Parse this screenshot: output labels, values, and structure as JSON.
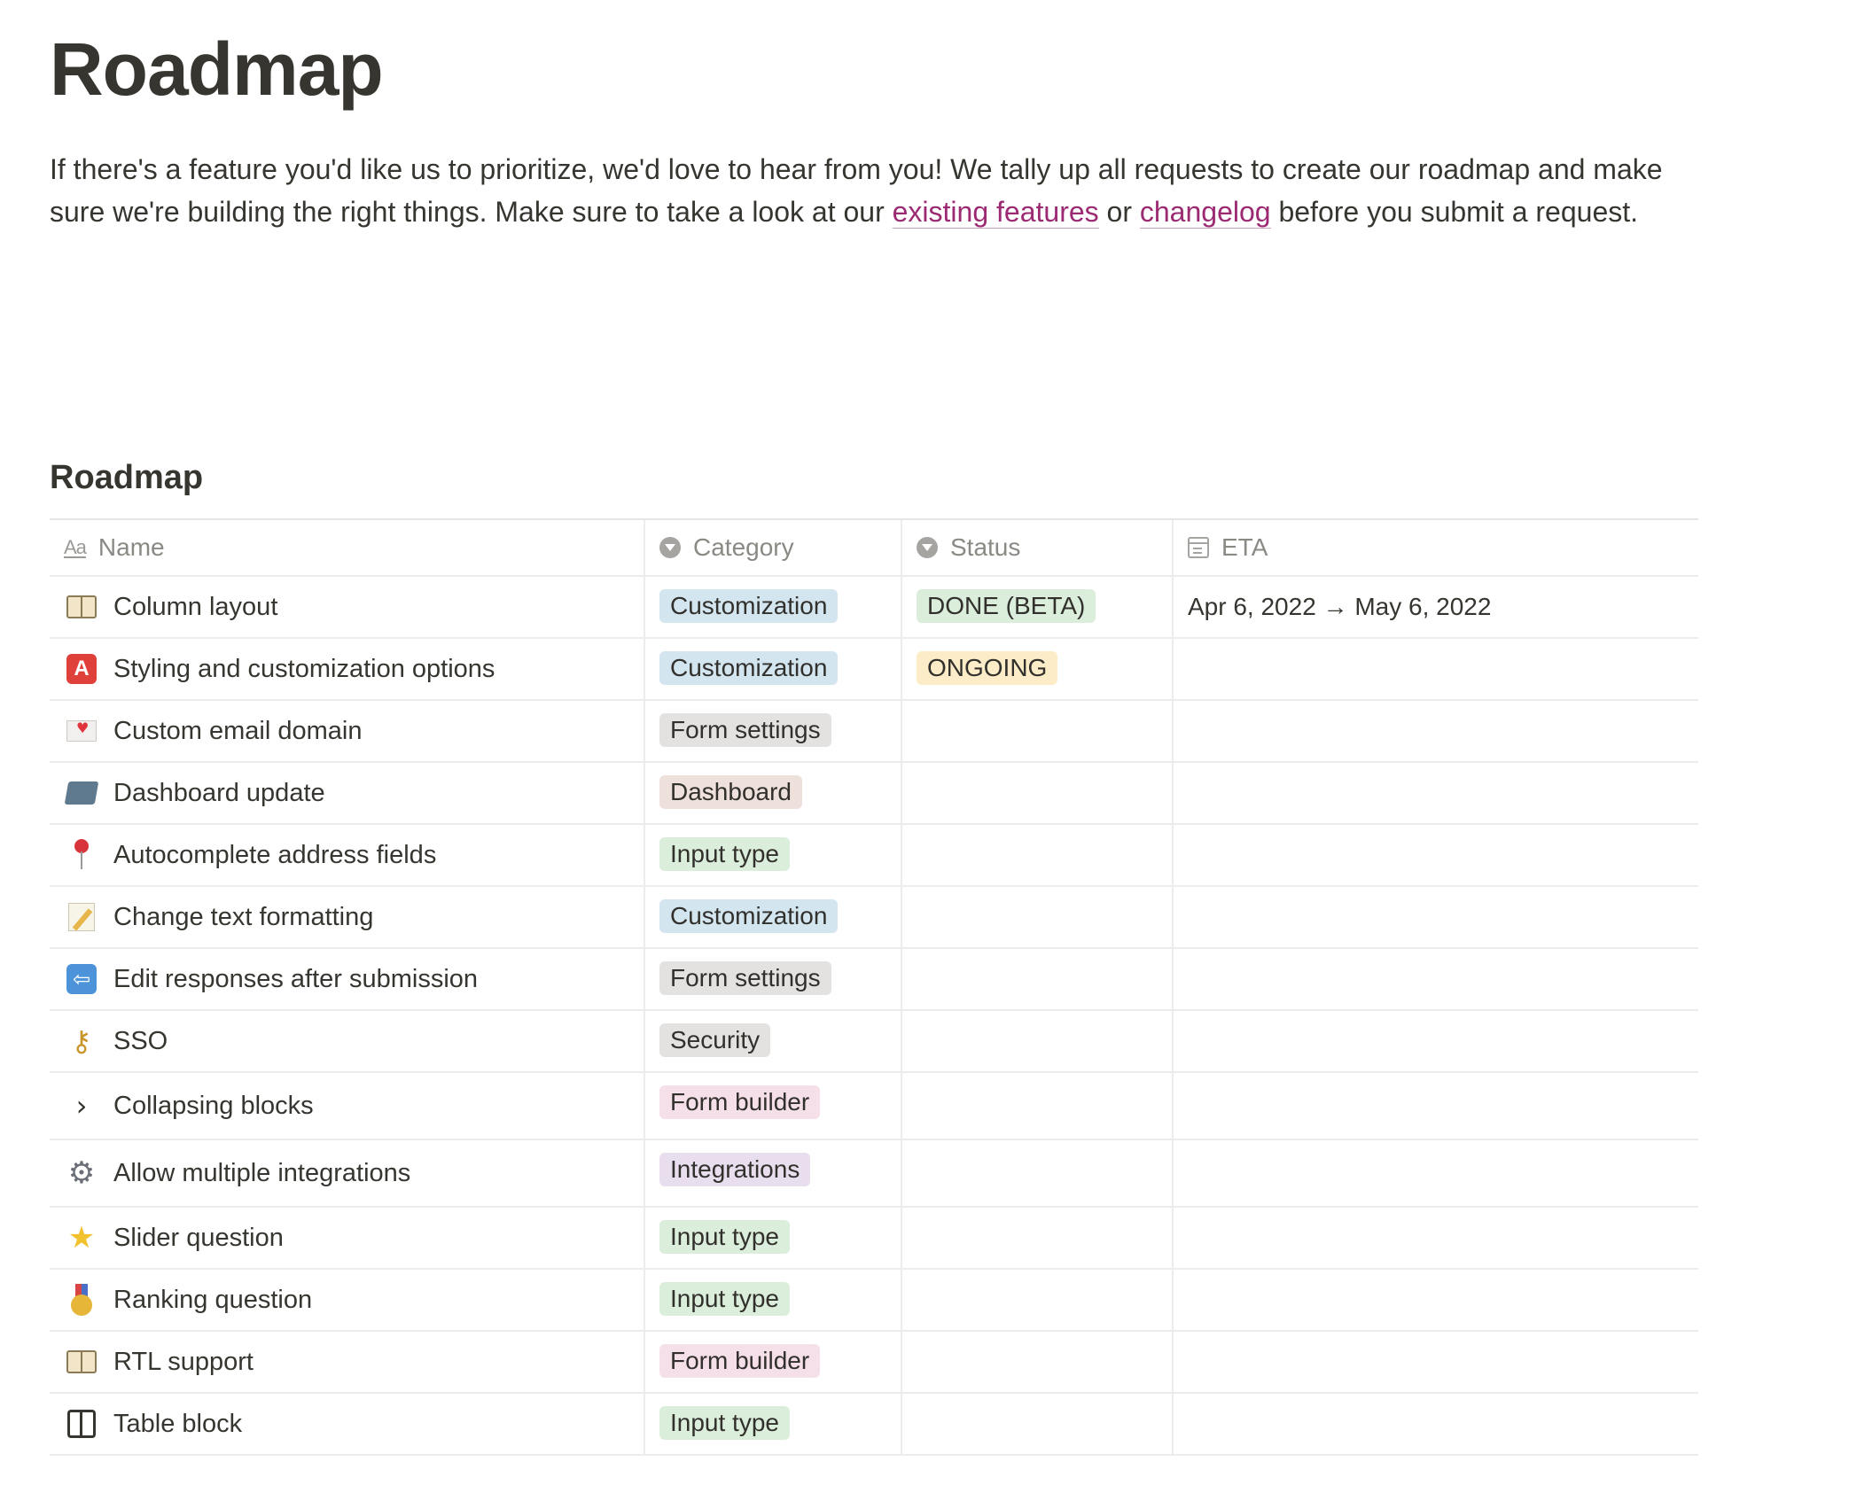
{
  "page": {
    "title": "Roadmap",
    "intro_before": "If there's a feature you'd like us to prioritize, we'd love to hear from you! We tally up all requests to create our roadmap and make sure we're building the right things. Make sure to take a look at our ",
    "link_existing": "existing features",
    "intro_or": " or ",
    "link_changelog": "changelog",
    "intro_after": " before you submit a request."
  },
  "database": {
    "title": "Roadmap",
    "columns": {
      "name": "Name",
      "category": "Category",
      "status": "Status",
      "eta": "ETA"
    },
    "header_icons": {
      "name": "Aa",
      "category": "select-icon",
      "status": "select-icon",
      "eta": "calendar-icon"
    },
    "tag_colors": {
      "Customization": "#d3e5ef",
      "Form settings": "#e3e2e0",
      "Dashboard": "#eee0da",
      "Input type": "#dbeddb",
      "Security": "#e3e2e0",
      "Form builder": "#f5e0e9",
      "Integrations": "#e8deee",
      "DONE (BETA)": "#dbeddb",
      "ONGOING": "#fdecc8"
    },
    "rows": [
      {
        "icon": "book-icon",
        "name": "Column layout",
        "category": "Customization",
        "status": "DONE (BETA)",
        "eta": "Apr 6, 2022 → May 6, 2022"
      },
      {
        "icon": "letter-a-icon",
        "name": "Styling and customization options",
        "category": "Customization",
        "status": "ONGOING",
        "eta": ""
      },
      {
        "icon": "love-letter-icon",
        "name": "Custom email domain",
        "category": "Form settings",
        "status": "",
        "eta": ""
      },
      {
        "icon": "folder-icon",
        "name": "Dashboard update",
        "category": "Dashboard",
        "status": "",
        "eta": ""
      },
      {
        "icon": "pin-icon",
        "name": "Autocomplete address fields",
        "category": "Input type",
        "status": "",
        "eta": ""
      },
      {
        "icon": "memo-icon",
        "name": "Change text formatting",
        "category": "Customization",
        "status": "",
        "eta": ""
      },
      {
        "icon": "back-arrow-icon",
        "name": "Edit responses after submission",
        "category": "Form settings",
        "status": "",
        "eta": ""
      },
      {
        "icon": "key-icon",
        "name": "SSO",
        "category": "Security",
        "status": "",
        "eta": ""
      },
      {
        "icon": "chevron-right-icon",
        "name": "Collapsing blocks",
        "category": "Form builder",
        "status": "",
        "eta": ""
      },
      {
        "icon": "gear-icon",
        "name": "Allow multiple integrations",
        "category": "Integrations",
        "status": "",
        "eta": ""
      },
      {
        "icon": "star-icon",
        "name": "Slider question",
        "category": "Input type",
        "status": "",
        "eta": ""
      },
      {
        "icon": "medal-icon",
        "name": "Ranking question",
        "category": "Input type",
        "status": "",
        "eta": ""
      },
      {
        "icon": "book-icon",
        "name": "RTL support",
        "category": "Form builder",
        "status": "",
        "eta": ""
      },
      {
        "icon": "table-icon",
        "name": "Table block",
        "category": "Input type",
        "status": "",
        "eta": ""
      }
    ]
  }
}
